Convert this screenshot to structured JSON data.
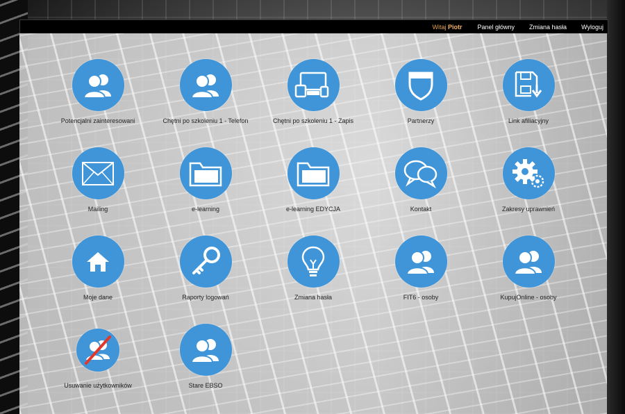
{
  "topbar": {
    "welcome_prefix": "Witaj",
    "user_name": "Piotr",
    "links": [
      "Panel główny",
      "Zmiana hasła",
      "Wyloguj"
    ]
  },
  "tiles": [
    {
      "label": "Potencjalni zainteresowani",
      "icon": "users-icon"
    },
    {
      "label": "Chętni po szkoleniu 1 - Telefon",
      "icon": "users-icon"
    },
    {
      "label": "Chętni po szkoleniu 1 - Zapis",
      "icon": "devices-icon"
    },
    {
      "label": "Partnerzy",
      "icon": "shield-icon"
    },
    {
      "label": "Link afiliacyjny",
      "icon": "save-download-icon"
    },
    {
      "label": "Mailing",
      "icon": "envelope-icon"
    },
    {
      "label": "e-learning",
      "icon": "folder-icon"
    },
    {
      "label": "e-learning EDYCJA",
      "icon": "folder-icon"
    },
    {
      "label": "Kontakt",
      "icon": "chat-bubbles-icon"
    },
    {
      "label": "Zakresy uprawnień",
      "icon": "gears-icon"
    },
    {
      "label": "Moje dane",
      "icon": "home-icon"
    },
    {
      "label": "Raporty logowań",
      "icon": "key-icon"
    },
    {
      "label": "Zmiana hasła",
      "icon": "lightbulb-icon"
    },
    {
      "label": "FIT6 - osoby",
      "icon": "users-icon"
    },
    {
      "label": "KupujOnline - osoby",
      "icon": "users-icon"
    },
    {
      "label": "Usuwanie użytkowników",
      "icon": "users-crossed-icon"
    },
    {
      "label": "Stare EBSO",
      "icon": "users-icon"
    }
  ],
  "colors": {
    "icon_circle": "#3f95d8",
    "topbar_bg": "#000000",
    "welcome_text": "#e0a050"
  }
}
